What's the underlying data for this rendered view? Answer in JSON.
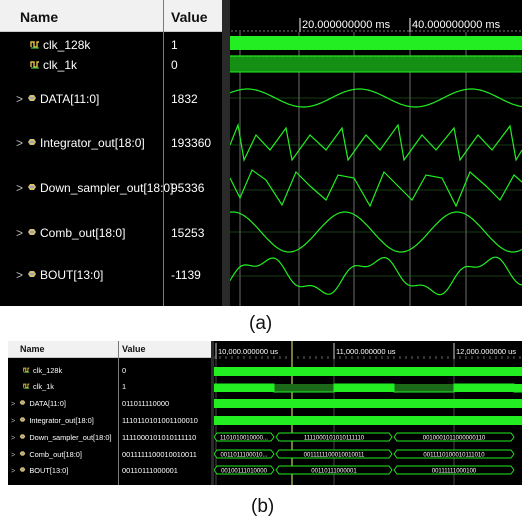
{
  "panel_a": {
    "headers": {
      "name": "Name",
      "value": "Value"
    },
    "rows": [
      {
        "name": "clk_128k",
        "value": "1",
        "icon": "clock-signal-icon"
      },
      {
        "name": "clk_1k",
        "value": "0",
        "icon": "clock-signal-icon"
      },
      {
        "name": "DATA[11:0]",
        "value": "1832",
        "icon": "bus-signal-icon"
      },
      {
        "name": "Integrator_out[18:0]",
        "value": "193360",
        "icon": "bus-signal-icon"
      },
      {
        "name": "Down_sampler_out[18:0]",
        "value": "95336",
        "icon": "bus-signal-icon"
      },
      {
        "name": "Comb_out[18:0]",
        "value": "15253",
        "icon": "bus-signal-icon"
      },
      {
        "name": "BOUT[13:0]",
        "value": "-1139",
        "icon": "bus-signal-icon"
      }
    ],
    "time_labels": [
      "20.000000000 ms",
      "40.000000000 ms"
    ],
    "caption": "(a)"
  },
  "panel_b": {
    "headers": {
      "name": "Name",
      "value": "Value"
    },
    "rows": [
      {
        "name": "clk_128k",
        "value": "0",
        "icon": "clock-signal-icon"
      },
      {
        "name": "clk_1k",
        "value": "1",
        "icon": "clock-signal-icon"
      },
      {
        "name": "DATA[11:0]",
        "value": "011011110000",
        "icon": "bus-signal-icon"
      },
      {
        "name": "Integrator_out[18:0]",
        "value": "1110110101001100010",
        "icon": "bus-signal-icon"
      },
      {
        "name": "Down_sampler_out[18:0]",
        "value": "1111000101010111110",
        "icon": "bus-signal-icon"
      },
      {
        "name": "Comb_out[18:0]",
        "value": "0011111100010010011",
        "icon": "bus-signal-icon"
      },
      {
        "name": "BOUT[13:0]",
        "value": "00110111000001",
        "icon": "bus-signal-icon"
      }
    ],
    "time_labels": [
      "10,000.000000 us",
      "11,000.000000 us",
      "12,000.000000 us"
    ],
    "bus_values": {
      "down_sampler": [
        "1101010010000...",
        "1111000101010111110",
        "0010001011000000110"
      ],
      "comb": [
        "0011011100010...",
        "0011111100010010011",
        "0011110100010111010"
      ],
      "bout": [
        "00100111010000",
        "00110111000001",
        "00111111000100"
      ]
    },
    "caption": "(b)"
  },
  "colors": {
    "signal": "#22ee22",
    "cursor": "#f0f070",
    "grid": "#ffffff",
    "background": "#000000"
  }
}
